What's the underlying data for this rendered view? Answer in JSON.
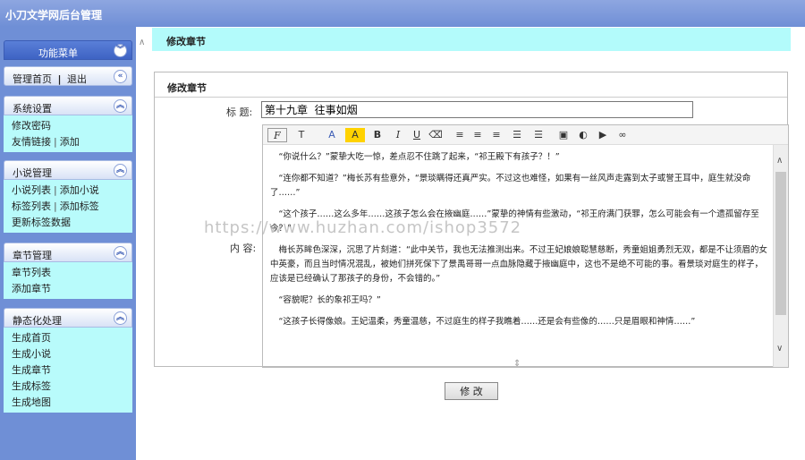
{
  "app_title": "小刀文学网后台管理",
  "sidebar": {
    "menu_title": "功能菜单",
    "quick": {
      "home": "管理首页",
      "sep": "|",
      "logout": "退出"
    },
    "sections": [
      {
        "title": "系统设置",
        "rows": [
          [
            "修改密码"
          ],
          [
            "友情链接",
            "添加"
          ]
        ]
      },
      {
        "title": "小说管理",
        "rows": [
          [
            "小说列表",
            "添加小说"
          ],
          [
            "标签列表",
            "添加标签"
          ],
          [
            "更新标签数据"
          ]
        ]
      },
      {
        "title": "章节管理",
        "rows": [
          [
            "章节列表"
          ],
          [
            "添加章节"
          ]
        ]
      },
      {
        "title": "静态化处理",
        "rows": [
          [
            "生成首页"
          ],
          [
            "生成小说"
          ],
          [
            "生成章节"
          ],
          [
            "生成标签"
          ],
          [
            "生成地图"
          ]
        ]
      }
    ]
  },
  "page": {
    "title": "修改章节",
    "form_title": "修改章节"
  },
  "form": {
    "title_label": "标 题:",
    "title_value": "第十九章  往事如烟",
    "content_label": "内 容:",
    "submit_label": "修 改"
  },
  "toolbar": [
    "F",
    "T",
    "A",
    "A",
    "B",
    "I",
    "U",
    "eraser",
    "align-left",
    "align-center",
    "align-right",
    "ordered-list",
    "unordered-list",
    "image",
    "flash",
    "media",
    "link"
  ],
  "editor_text": [
    "“你说什么？”蒙挚大吃一惊，差点忍不住跳了起来，“祁王殿下有孩子？！”",
    "“连你都不知道？”梅长苏有些意外，“景琰瞒得还真严实。不过这也难怪，如果有一丝风声走露到太子或誉王耳中，庭生就没命了……”",
    "“这个孩子……这么多年……这孩子怎么会在掖幽庭……”蒙挚的神情有些激动，“祁王府满门获罪，怎么可能会有一个遗孤留存至今？”",
    "梅长苏眸色深深，沉思了片刻道：“此中关节，我也无法推测出来。不过王妃娘娘聪慧慈断，秀童姐姐勇烈无双，都是不让须眉的女中英豪，而且当时情况混乱，被她们拼死保下了景禹哥哥一点血脉隐藏于掖幽庭中，这也不是绝不可能的事。看景琰对庭生的样子，应该是已经确认了那孩子的身份，不会错的。”",
    "“容貌呢？长的象祁王吗？”",
    "“这孩子长得像娘。王妃温柔，秀童温慈，不过庭生的样子我瞧着……还是会有些像的……只是眉眼和神情……”"
  ],
  "watermark": "https://www.huzhan.com/ishop3572"
}
